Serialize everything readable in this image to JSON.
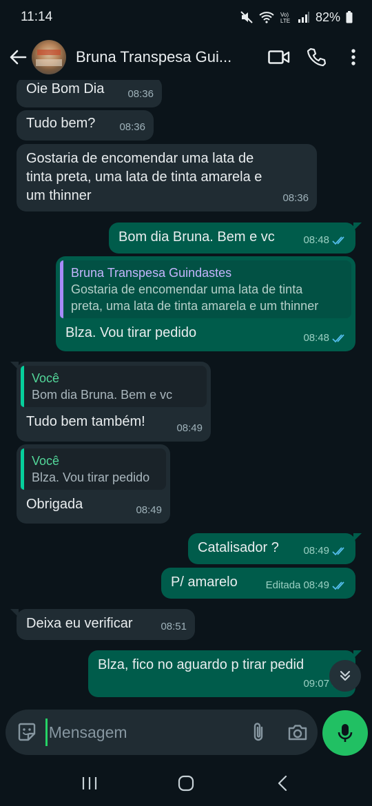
{
  "status": {
    "time": "11:14",
    "battery": "82%"
  },
  "header": {
    "contact_name": "Bruna Transpesa Gui..."
  },
  "messages": [
    {
      "dir": "in",
      "text": "Oie Bom Dia",
      "time": "08:36"
    },
    {
      "dir": "in",
      "text": "Tudo bem?",
      "time": "08:36"
    },
    {
      "dir": "in",
      "text_lines": [
        "Gostaria de encomendar uma lata de",
        "tinta preta, uma lata de tinta amarela e",
        "um thinner"
      ],
      "time": "08:36"
    },
    {
      "dir": "out",
      "text": "Bom dia Bruna. Bem e vc",
      "time": "08:48"
    },
    {
      "dir": "out",
      "quote_author": "Bruna Transpesa Guindastes",
      "quote_lines": [
        "Gostaria de encomendar uma lata de tinta",
        "preta, uma lata de tinta amarela e um thinner"
      ],
      "text": "Blza. Vou tirar pedido",
      "time": "08:48"
    },
    {
      "dir": "in",
      "quote_author": "Você",
      "quote_text": "Bom dia Bruna. Bem e vc",
      "text": "Tudo bem também!",
      "time": "08:49"
    },
    {
      "dir": "in",
      "quote_author": "Você",
      "quote_text": "Blza. Vou tirar pedido",
      "text": "Obrigada",
      "time": "08:49"
    },
    {
      "dir": "out",
      "text": "Catalisador  ?",
      "time": "08:49"
    },
    {
      "dir": "out",
      "text": "P/ amarelo",
      "edited": "Editada",
      "time": "08:49"
    },
    {
      "dir": "in",
      "text": "Deixa eu verificar",
      "time": "08:51"
    },
    {
      "dir": "out",
      "text": "Blza, fico no  aguardo  p tirar pedid",
      "time": "09:07"
    }
  ],
  "composer": {
    "placeholder": "Mensagem"
  },
  "colors": {
    "accent": "#21c063",
    "outgoing": "#005c4b",
    "incoming": "#202c33",
    "read_ticks": "#53bdeb"
  }
}
